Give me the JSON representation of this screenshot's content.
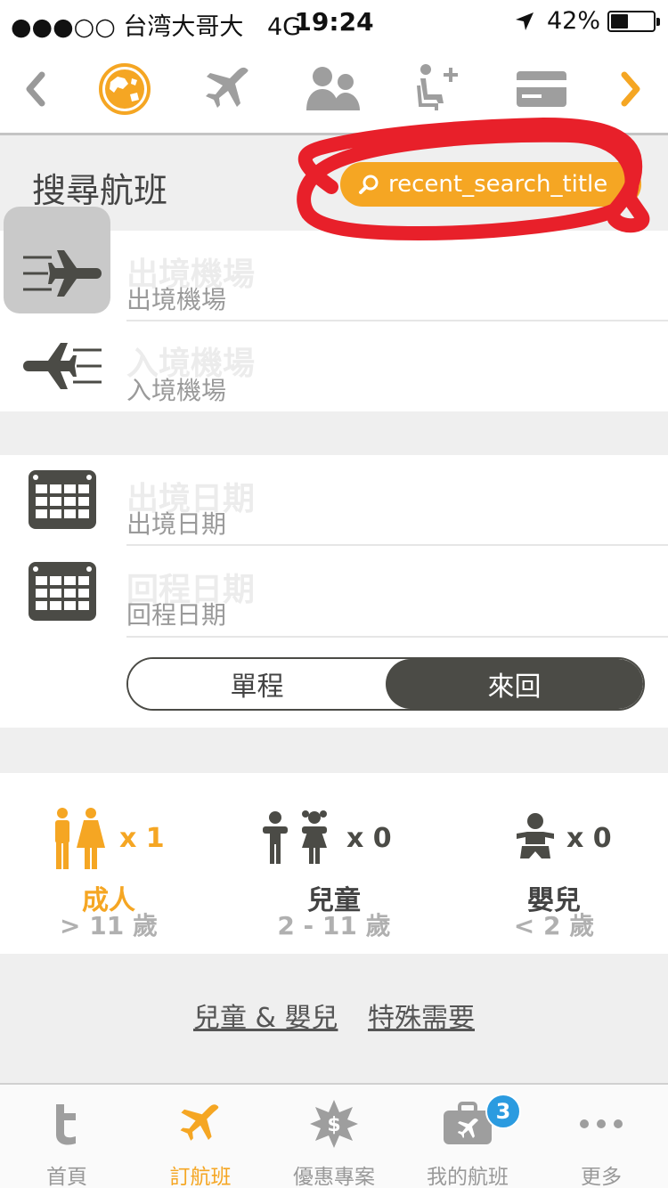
{
  "status_bar": {
    "signal": "●●●○○",
    "carrier": "台湾大哥大",
    "network": "4G",
    "time": "19:24",
    "battery_percent": "42%",
    "battery_level": 0.42
  },
  "top_nav": {
    "icons": [
      "chevron-left-icon",
      "globe-icon",
      "airplane-icon",
      "passengers-icon",
      "seat-plus-icon",
      "credit-card-icon",
      "chevron-right-icon"
    ],
    "active": "globe-icon"
  },
  "search": {
    "title": "搜尋航班",
    "recent_button": "recent_search_title"
  },
  "airports": {
    "departure_placeholder": "出境機場",
    "departure_label": "出境機場",
    "arrival_placeholder": "入境機場",
    "arrival_label": "入境機場"
  },
  "dates": {
    "departure_placeholder": "出境日期",
    "departure_label": "出境日期",
    "return_placeholder": "回程日期",
    "return_label": "回程日期"
  },
  "trip_type": {
    "one_way": "單程",
    "round_trip": "來回",
    "selected": "round_trip"
  },
  "passengers": {
    "adult": {
      "count": "x 1",
      "label": "成人",
      "range": "> 11 歲"
    },
    "child": {
      "count": "x 0",
      "label": "兒童",
      "range": "2 - 11 歲"
    },
    "infant": {
      "count": "x 0",
      "label": "嬰兒",
      "range": "< 2 歲"
    }
  },
  "links": {
    "children_infants": "兒童 & 嬰兒",
    "special_needs": "特殊需要"
  },
  "tabbar": {
    "items": [
      {
        "label": "首頁",
        "icon": "home-t-icon"
      },
      {
        "label": "訂航班",
        "icon": "airplane-icon",
        "active": true
      },
      {
        "label": "優惠專案",
        "icon": "deals-star-icon"
      },
      {
        "label": "我的航班",
        "icon": "luggage-icon",
        "badge": "3"
      },
      {
        "label": "更多",
        "icon": "more-dots-icon"
      }
    ]
  },
  "colors": {
    "accent": "#f5a623",
    "dark": "#4b4b46",
    "badge": "#2b9be0",
    "annotation": "#e8202a"
  }
}
